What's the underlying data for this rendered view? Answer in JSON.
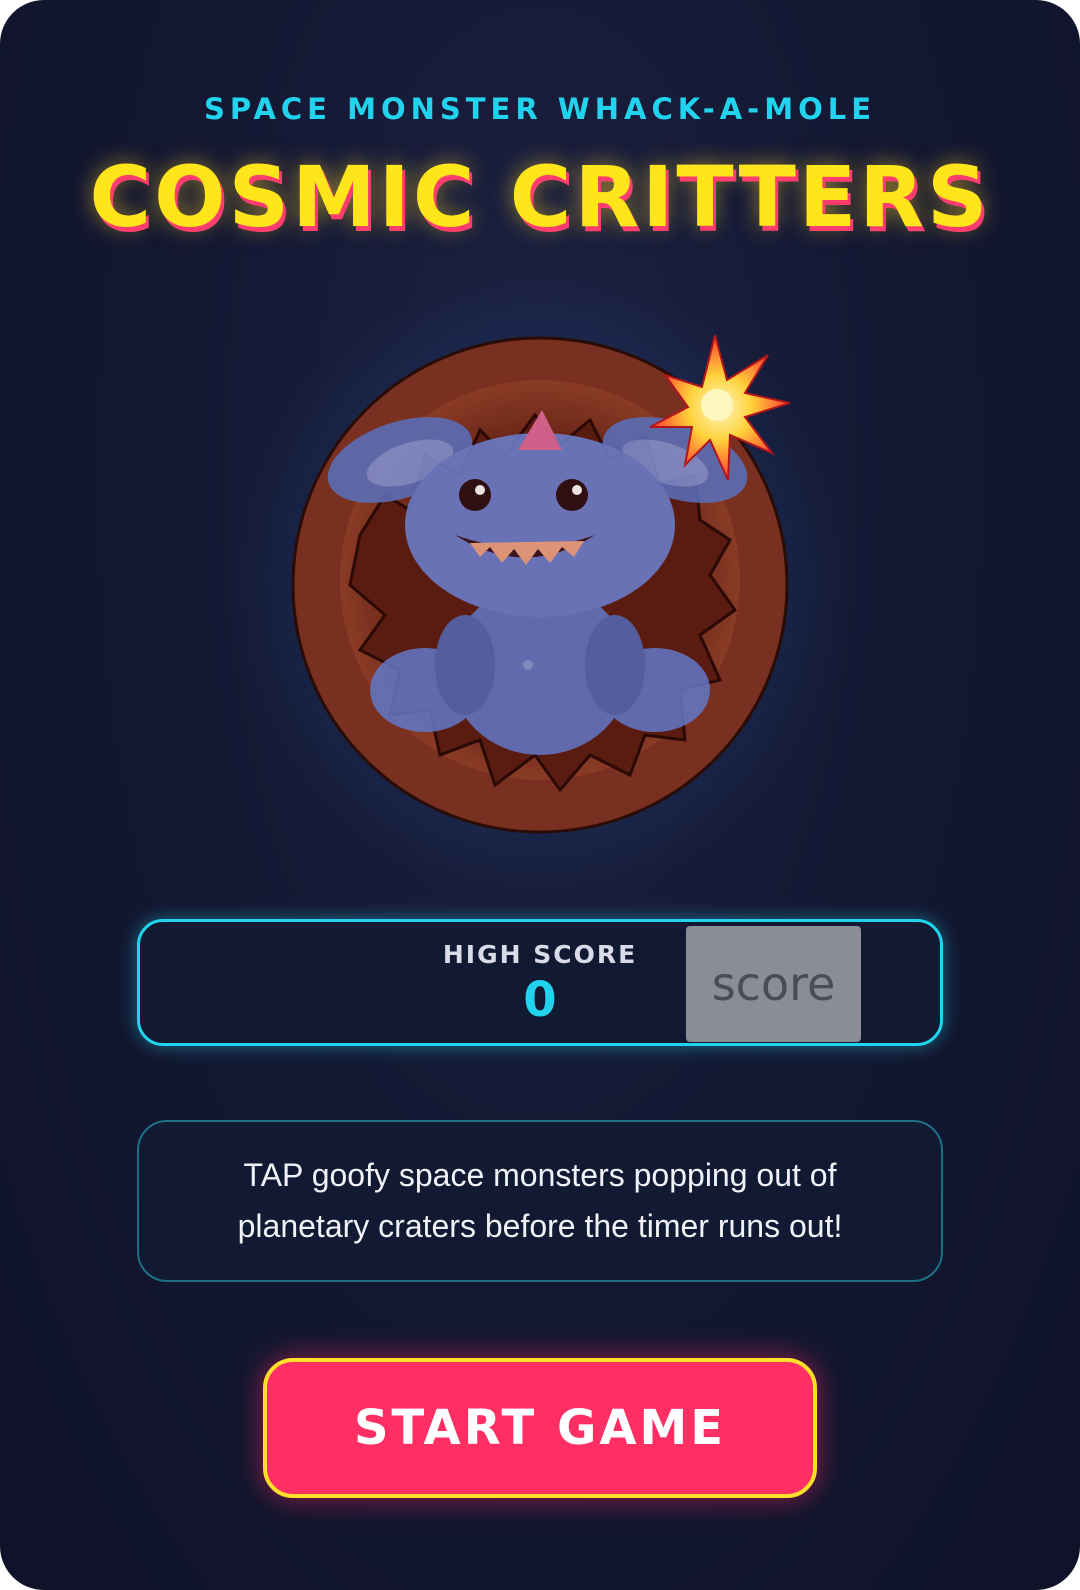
{
  "header": {
    "subtitle": "SPACE MONSTER WHACK-A-MOLE",
    "title": "COSMIC CRITTERS"
  },
  "hero": {
    "image": "space-monster-in-crater",
    "effect": "impact-burst"
  },
  "high_score": {
    "label": "HIGH SCORE",
    "value": "0",
    "overlay_text": "score"
  },
  "instructions": {
    "text": "TAP goofy space monsters popping out of planetary craters before the timer runs out!"
  },
  "start_button": {
    "label": "START GAME"
  },
  "colors": {
    "background": "#141833",
    "accent_cyan": "#22d3ee",
    "title_yellow": "#ffe51a",
    "title_shadow": "#ff3d6e",
    "button": "#ff2f64",
    "button_border": "#ffdf28"
  }
}
